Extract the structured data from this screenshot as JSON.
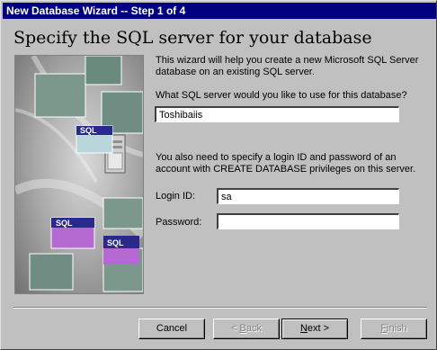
{
  "window": {
    "title": "New Database Wizard -- Step 1 of 4"
  },
  "heading": "Specify the SQL server for your database",
  "intro": {
    "line1": "This wizard will help you create a new Microsoft SQL Server",
    "line2": "database on an existing SQL server."
  },
  "server_question": "What SQL server would you like to use for this database?",
  "server_value": "Toshibaiis",
  "login_info": {
    "line1": "You also need to specify a login ID and password of an",
    "line2": "account with CREATE DATABASE privileges on this server."
  },
  "login": {
    "label": "Login ID:",
    "value": "sa"
  },
  "password": {
    "label": "Password:",
    "value": ""
  },
  "art_badges": {
    "top": "SQL",
    "left": "SQL",
    "right": "SQL"
  },
  "buttons": {
    "cancel": "Cancel",
    "back_prefix": "< ",
    "back_key": "B",
    "back_rest": "ack",
    "next_key": "N",
    "next_rest": "ext >",
    "finish_key": "F",
    "finish_rest": "inish"
  }
}
